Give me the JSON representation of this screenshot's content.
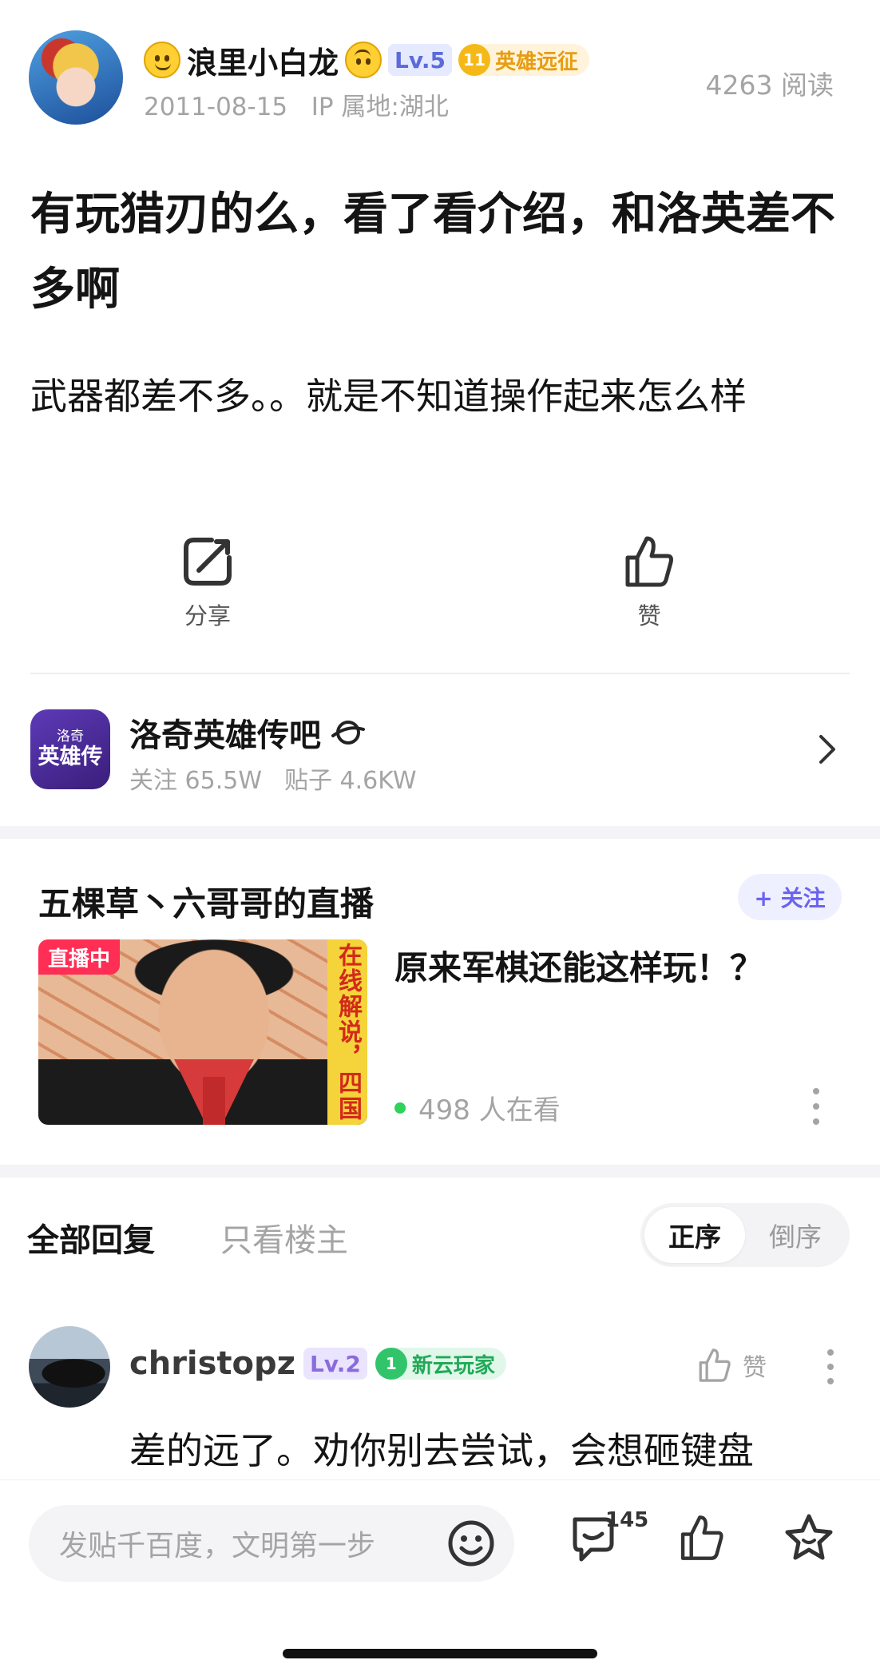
{
  "author": {
    "name": "浪里小白龙",
    "level": "Lv.5",
    "badge_number": "11",
    "badge_label": "英雄远征",
    "date": "2011-08-15",
    "ip_location": "IP 属地:湖北",
    "read_count": "4263 阅读"
  },
  "post": {
    "title": "有玩猎刃的么，看了看介绍，和洛英差不多啊",
    "body": "武器都差不多。。就是不知道操作起来怎么样"
  },
  "actions": {
    "share_label": "分享",
    "like_label": "赞"
  },
  "forum": {
    "logo_top": "洛奇",
    "logo_main": "英雄传",
    "name": "洛奇英雄传吧",
    "followers": "关注 65.5W",
    "posts": "贴子 4.6KW"
  },
  "live": {
    "streamer_title": "五棵草丶六哥哥的直播",
    "follow_label": "+ 关注",
    "status_tag": "直播中",
    "banner_text": "在线解说，四国",
    "headline": "原来军棋还能这样玩！？",
    "viewers": "498 人在看"
  },
  "replies": {
    "tab_all": "全部回复",
    "tab_op_only": "只看楼主",
    "sort_asc": "正序",
    "sort_desc": "倒序",
    "first": {
      "username": "christopz",
      "level": "Lv.2",
      "badge_number": "1",
      "badge_label": "新云玩家",
      "like_label": "赞",
      "text": "差的远了。劝你别去尝试，会想砸键盘"
    }
  },
  "bottom_bar": {
    "compose_placeholder": "发贴千百度，文明第一步",
    "comment_count": "145"
  },
  "colors": {
    "accent": "#6c63f0",
    "live_red": "#ff2e55",
    "live_green": "#2fd25a",
    "hero_gold": "#f5b917",
    "newbie_green": "#31c46b"
  }
}
